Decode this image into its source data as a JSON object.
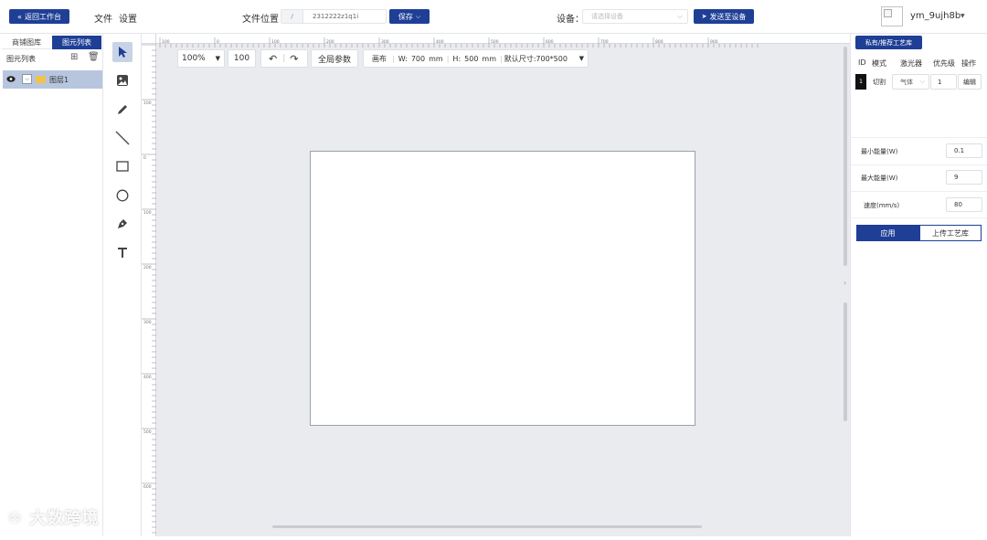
{
  "topbar": {
    "back_label": "返回工作台",
    "menu_file": "文件",
    "menu_settings": "设置",
    "file_location_label": "文件位置",
    "path_prefix": "/",
    "file_name": "2312222z1q1i",
    "save_label": "保存",
    "device_label": "设备：",
    "device_placeholder": "请选择设备",
    "send_label": "发送至设备",
    "username": "ym_9ujh8b"
  },
  "left_panel": {
    "tabs": [
      {
        "label": "商铺图库"
      },
      {
        "label": "图元列表"
      }
    ],
    "title": "图元列表",
    "layers": [
      {
        "name": "图层1"
      }
    ]
  },
  "tools": [
    {
      "name": "select-arrow-icon"
    },
    {
      "name": "image-icon"
    },
    {
      "name": "pencil-icon"
    },
    {
      "name": "line-icon"
    },
    {
      "name": "rectangle-icon"
    },
    {
      "name": "circle-icon"
    },
    {
      "name": "pen-tool-icon"
    },
    {
      "name": "text-icon"
    }
  ],
  "canvas_toolbar": {
    "zoom": "100%",
    "zoom_input": "100",
    "global_params": "全局参数",
    "canvas_label": "画布",
    "width_label": "W:",
    "width_value": "700",
    "width_unit": "mm",
    "height_label": "H:",
    "height_value": "500",
    "height_unit": "mm",
    "default_size": "默认尺寸:700*500"
  },
  "rulers": {
    "top_ticks": [
      "300",
      "200",
      "100",
      "0",
      "100",
      "200",
      "300",
      "400",
      "500",
      "600",
      "700",
      "800",
      "900"
    ],
    "left_ticks": [
      "100",
      "0",
      "100",
      "200",
      "300",
      "400",
      "500",
      "600",
      "700"
    ]
  },
  "watermark": "大数跨境",
  "right_panel": {
    "library_button": "私有/推荐工艺库",
    "table_headers": {
      "id": "ID",
      "mode": "模式",
      "laser": "激光器",
      "priority": "优先级",
      "action": "操作"
    },
    "row": {
      "id": "1",
      "mode": "切割",
      "laser": "气体",
      "priority": "1",
      "action": "编辑"
    },
    "params": [
      {
        "label": "最小能量(W)",
        "value": "0.1"
      },
      {
        "label": "最大能量(W)",
        "value": "9"
      },
      {
        "label": "速度(mm/s)",
        "value": "80"
      }
    ],
    "apply_label": "应用",
    "upload_label": "上传工艺库"
  },
  "colors": {
    "primary": "#1f3f96",
    "canvas_bg": "#e9ebef",
    "active_tool": "#c8d3e6",
    "layer_selected": "#b7c6de"
  }
}
